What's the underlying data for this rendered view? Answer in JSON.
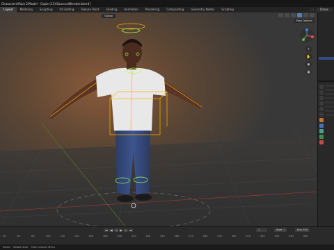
{
  "window": {
    "title": "Characters\\Pack 2\\Model - Copie (13)\\Sources\\Blender.blend]"
  },
  "workspace_tabs": [
    "Layout",
    "Modeling",
    "Sculpting",
    "UV Editing",
    "Texture Paint",
    "Shading",
    "Animation",
    "Rendering",
    "Compositing",
    "Geometry Nodes",
    "Scripting"
  ],
  "active_tab": "Layout",
  "scene_label": "Scene",
  "viewport": {
    "mode_label": "Global",
    "pose_options_label": "Pose Options"
  },
  "timeline": {
    "current_frame": "1",
    "start_label": "Start",
    "start_value": "1",
    "end_label": "End",
    "end_value": "250",
    "ruler_ticks": [
      "40",
      "60",
      "80",
      "100",
      "120",
      "140",
      "160",
      "180",
      "200",
      "220",
      "240",
      "250",
      "260",
      "270",
      "280",
      "290",
      "300",
      "310",
      "320",
      "330",
      "340",
      "350"
    ]
  },
  "statusbar": {
    "left_text": "Select",
    "middle_text": "Rotate View",
    "right_text": "Pose Context Menu"
  },
  "colors": {
    "armature_selected": "#ffb400",
    "armature_active": "#9dff4a",
    "viewport_bg": "#3b3b3b",
    "accent": "#5c7ea8"
  }
}
